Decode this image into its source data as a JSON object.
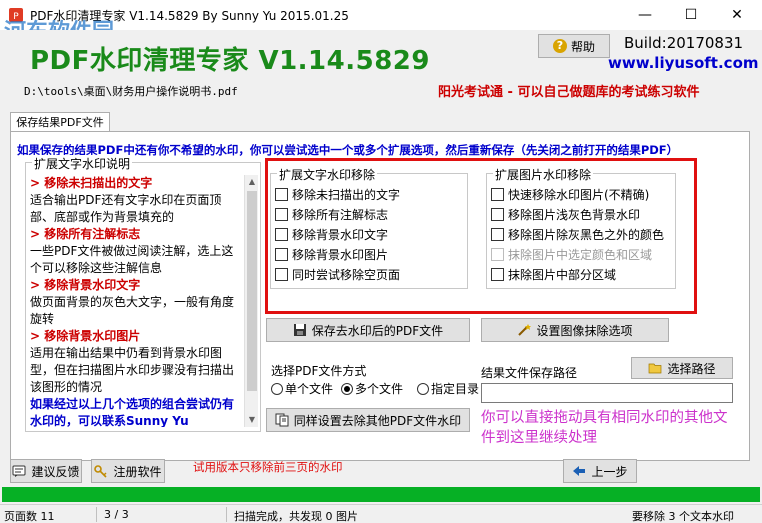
{
  "window": {
    "title": "PDF水印清理专家 V1.14.5829 By Sunny Yu 2015.01.25",
    "watermark": "河东软件园",
    "minimize": "—",
    "maximize": "☐",
    "close": "✕"
  },
  "header": {
    "app_title": "PDF水印清理专家 V1.14.5829",
    "help_label": "帮助",
    "build": "Build:20170831",
    "website": "www.liyusoft.com",
    "file_path": "D:\\tools\\桌面\\财务用户操作说明书.pdf",
    "promo": "阳光考试通 - 可以自己做题库的考试练习软件"
  },
  "tab": {
    "label": "保存结果PDF文件"
  },
  "info_line": "如果保存的结果PDF中还有你不希望的水印，你可以尝试选中一个或多个扩展选项，然后重新保存（先关闭之前打开的结果PDF）",
  "explain": {
    "legend": "扩展文字水印说明",
    "lines": [
      {
        "type": "h",
        "text": "> 移除未扫描出的文字"
      },
      {
        "type": "p",
        "text": "  适合输出PDF还有文字水印在页面顶部、底部或作为背景填充的"
      },
      {
        "type": "h",
        "text": "> 移除所有注解标志"
      },
      {
        "type": "p",
        "text": "  一些PDF文件被做过阅读注解，选上这个可以移除这些注解信息"
      },
      {
        "type": "h",
        "text": "> 移除背景水印文字"
      },
      {
        "type": "p",
        "text": "  做页面背景的灰色大文字，一般有角度旋转"
      },
      {
        "type": "h",
        "text": "> 移除背景水印图片"
      },
      {
        "type": "p",
        "text": "  适用在输出结果中仍看到背景水印图型，但在扫描图片水印步骤没有扫描出该图形的情况"
      },
      {
        "type": "b",
        "text": "如果经过以上几个选项的组合尝试仍有水印的，可以联系Sunny Yu"
      }
    ]
  },
  "text_group": {
    "legend": "扩展文字水印移除",
    "options": [
      {
        "label": "移除未扫描出的文字",
        "checked": false
      },
      {
        "label": "移除所有注解标志",
        "checked": false
      },
      {
        "label": "移除背景水印文字",
        "checked": false
      },
      {
        "label": "移除背景水印图片",
        "checked": false
      },
      {
        "label": "同时尝试移除空页面",
        "checked": false
      }
    ]
  },
  "image_group": {
    "legend": "扩展图片水印移除",
    "options": [
      {
        "label": "快速移除水印图片(不精确)",
        "checked": false,
        "disabled": false
      },
      {
        "label": "移除图片浅灰色背景水印",
        "checked": false,
        "disabled": false
      },
      {
        "label": "移除图片除灰黑色之外的颜色",
        "checked": false,
        "disabled": false
      },
      {
        "label": "抹除图片中选定颜色和区域",
        "checked": false,
        "disabled": true
      },
      {
        "label": "抹除图片中部分区域",
        "checked": false,
        "disabled": false
      }
    ]
  },
  "buttons": {
    "save_pdf": "保存去水印后的PDF文件",
    "image_erase": "设置图像抹除选项",
    "choose_path": "选择路径",
    "same_settings": "同样设置去除其他PDF文件水印",
    "feedback": "建议反馈",
    "register": "注册软件",
    "prev_step": "上一步"
  },
  "pdf_mode": {
    "title": "选择PDF文件方式",
    "options": [
      {
        "label": "单个文件",
        "selected": false
      },
      {
        "label": "多个文件",
        "selected": true
      },
      {
        "label": "指定目录",
        "selected": false
      }
    ]
  },
  "save_path": {
    "label": "结果文件保存路径",
    "value": ""
  },
  "drag_hint": "你可以直接拖动具有相同水印的其他文件到这里继续处理",
  "trial_note": "试用版本只移除前三页的水印",
  "progress": {
    "fraction": 1.0,
    "color": "#06b025"
  },
  "status": {
    "pages": "页面数 11",
    "page_pos": "3 / 3",
    "scan": "扫描完成，共发现 0 图片",
    "remove": "要移除 3 个文本水印"
  }
}
